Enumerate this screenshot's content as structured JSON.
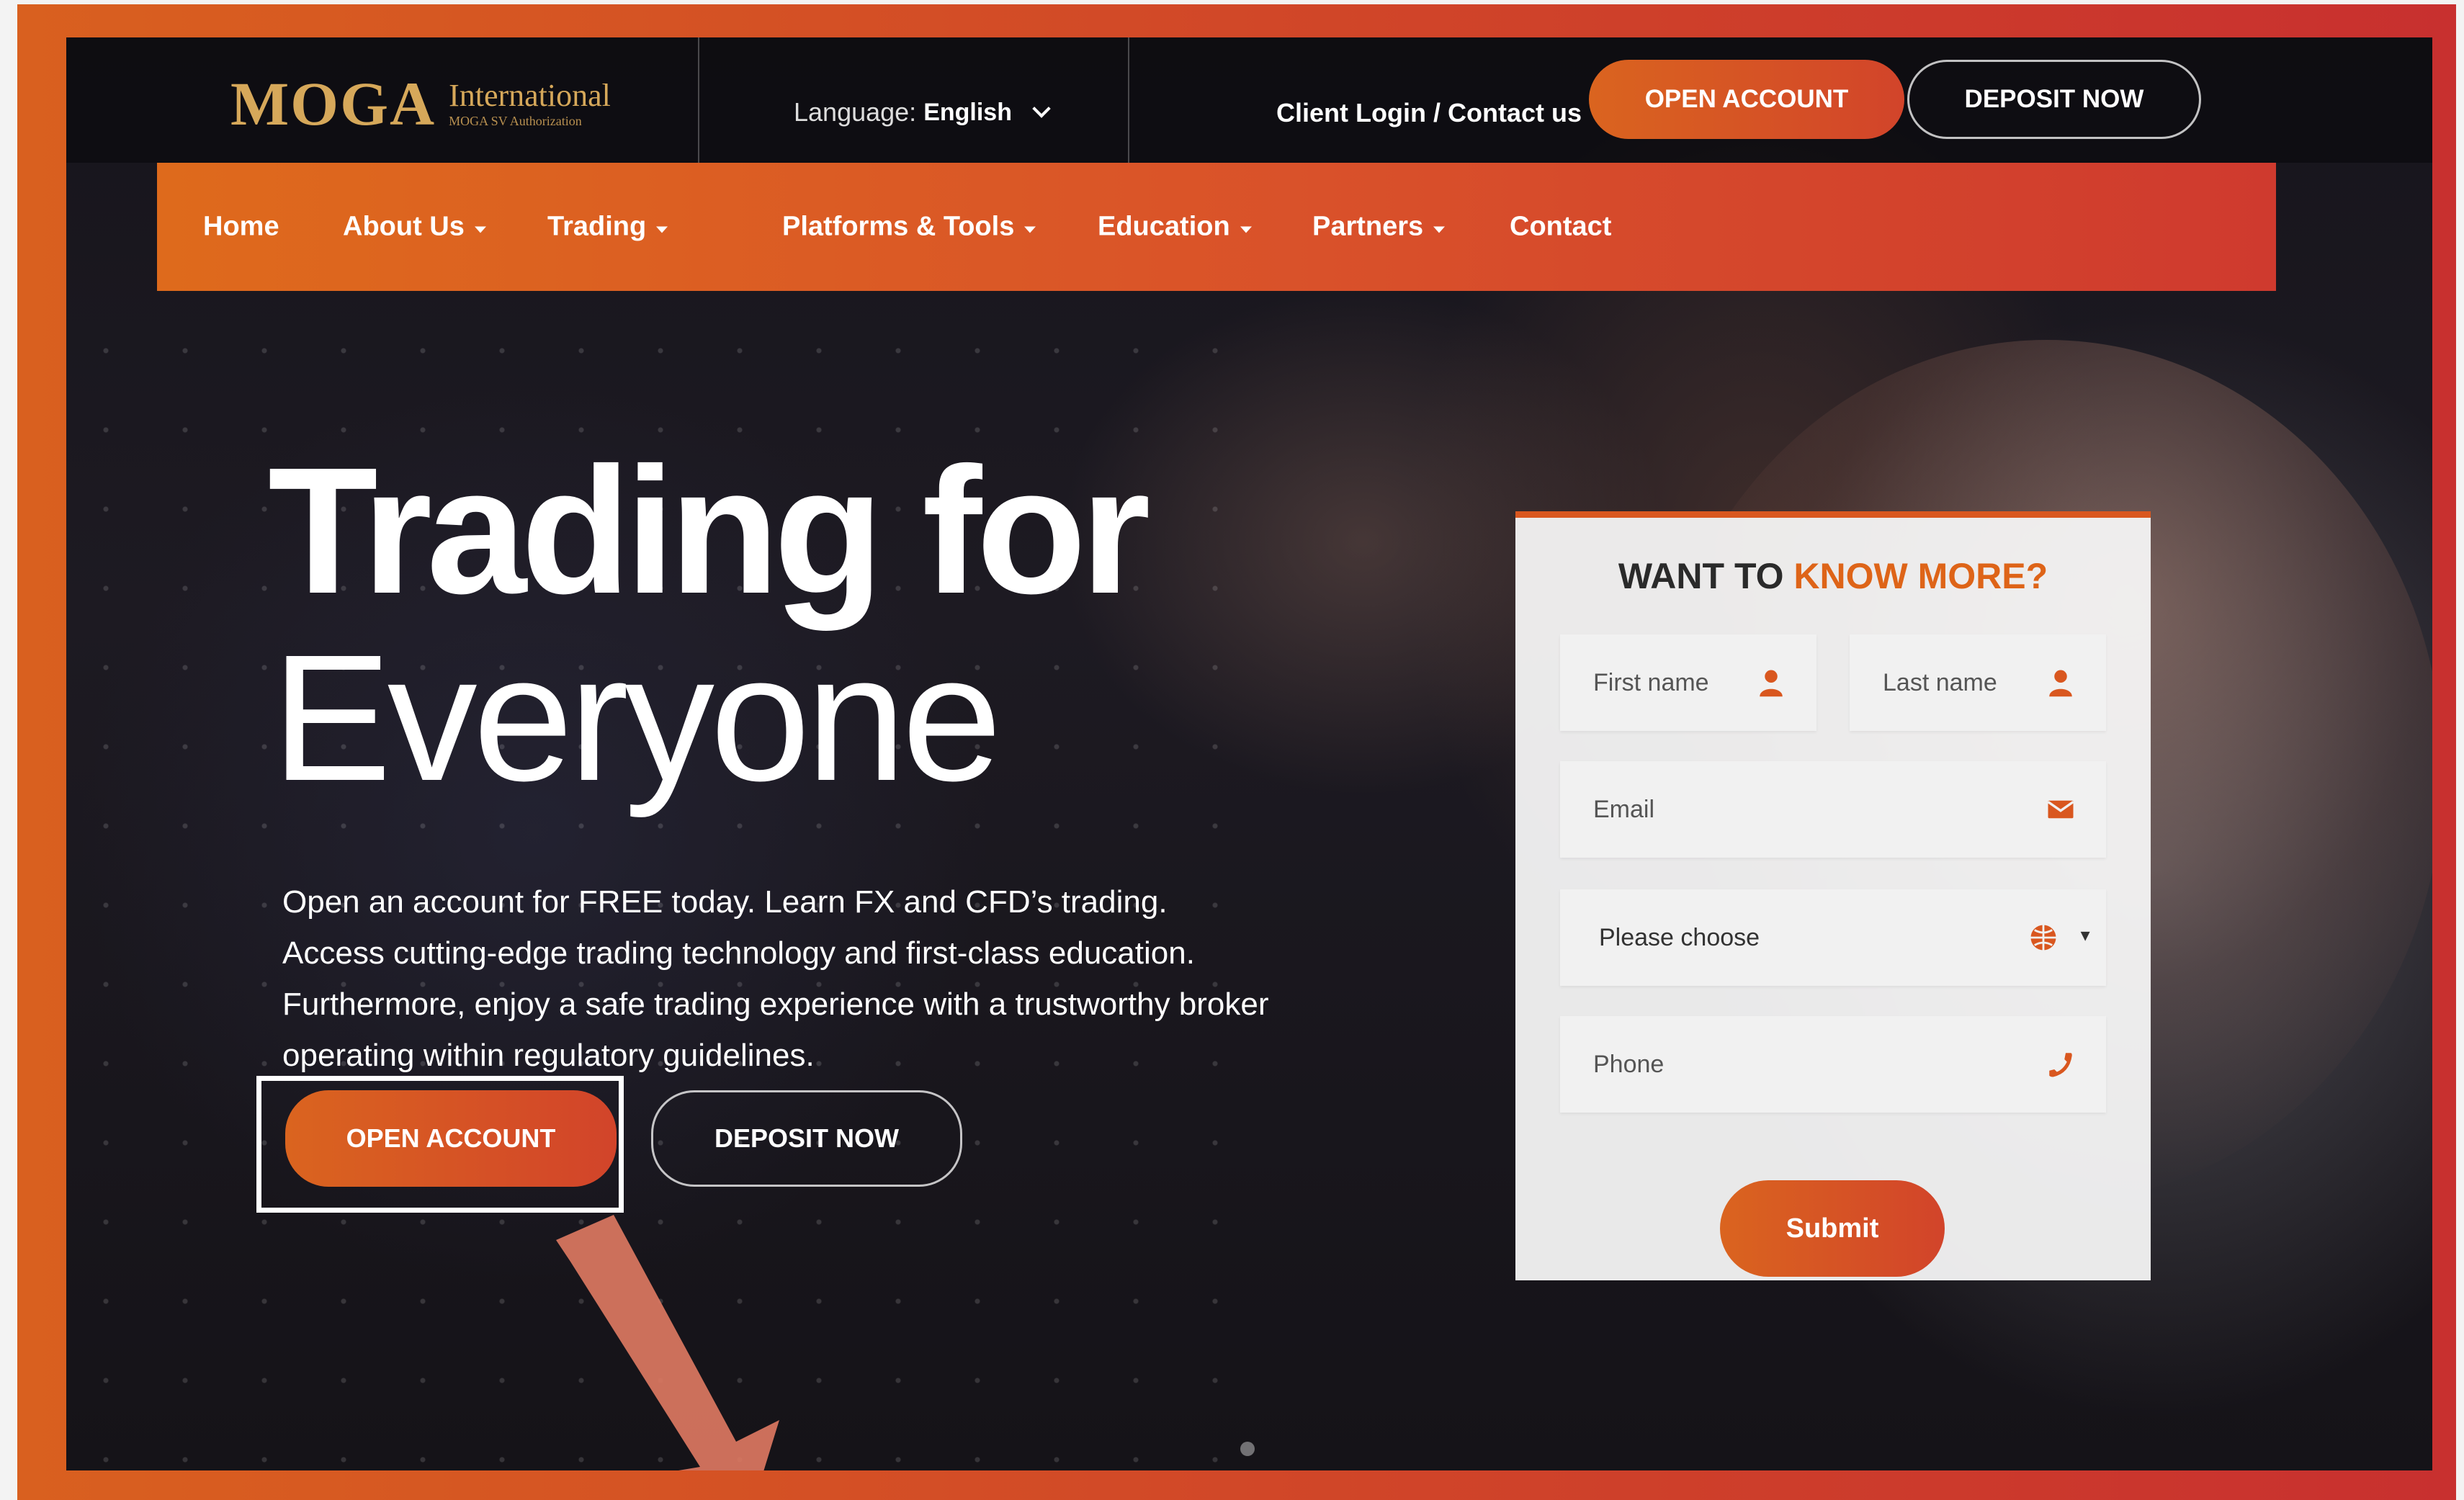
{
  "topbar": {
    "logo_mark": "MOGA",
    "logo_name": "International",
    "logo_sub": "MOGA SV Authorization",
    "language_label": "Language:",
    "language_value": "English",
    "client_link": "Client Login / Contact us",
    "open_account": "OPEN ACCOUNT",
    "deposit_now": "DEPOSIT NOW"
  },
  "nav": {
    "items": [
      {
        "label": "Home"
      },
      {
        "label": "About Us"
      },
      {
        "label": "Trading"
      },
      {
        "label": "Platforms & Tools"
      },
      {
        "label": "Education"
      },
      {
        "label": "Partners"
      },
      {
        "label": "Contact"
      }
    ]
  },
  "hero": {
    "title_line1": "Trading for",
    "title_line2": "Everyone",
    "para_lines": [
      "Open an account for FREE today. Learn FX and CFD’s trading.",
      "Access cutting-edge trading technology and first-class education.",
      "Furthermore, enjoy a safe trading experience with a trustworthy broker",
      "operating within regulatory guidelines."
    ],
    "open_account": "OPEN ACCOUNT",
    "deposit_now": "DEPOSIT NOW"
  },
  "form": {
    "title_plain": "WANT TO ",
    "title_highlight": "KNOW MORE?",
    "first_name": "First name",
    "last_name": "Last name",
    "email": "Email",
    "country": "Please choose",
    "phone": "Phone",
    "submit": "Submit"
  },
  "colors": {
    "accent": "#de6418",
    "accent_red": "#d2442a",
    "frame": "#d24a27"
  }
}
